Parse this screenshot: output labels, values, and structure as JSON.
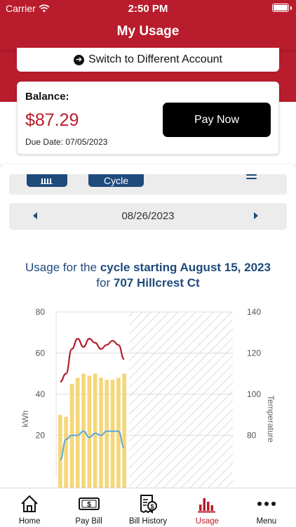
{
  "status_bar": {
    "carrier": "Carrier",
    "time": "2:50 PM"
  },
  "nav": {
    "title": "My Usage"
  },
  "account": {
    "switch_label": "Switch to Different Account"
  },
  "balance": {
    "label": "Balance:",
    "amount": "$87.29",
    "due_date": "Due Date: 07/05/2023",
    "pay_button": "Pay Now"
  },
  "view_toggle": {
    "cycle_label": "Cycle"
  },
  "date_nav": {
    "date": "08/26/2023"
  },
  "usage_heading": {
    "prefix": "Usage for the ",
    "cycle_text": "cycle starting August 15, 2023",
    "for_text": "for ",
    "address": "707 Hillcrest Ct"
  },
  "chart_data": {
    "type": "bar",
    "xlabel": "",
    "ylabel": "kWh",
    "ylabel_right": "Temperature",
    "ylim": [
      0,
      80
    ],
    "ylim_right": [
      60,
      140
    ],
    "y_ticks": [
      20,
      40,
      60,
      80
    ],
    "y_ticks_right": [
      80,
      100,
      120,
      140
    ],
    "bar_color": "#f5d77a",
    "values": [
      30,
      29,
      45,
      48,
      50,
      49,
      50,
      48,
      47,
      47,
      48,
      50
    ],
    "series": [
      {
        "values": [
          106,
          110,
          122,
          127,
          123,
          127,
          125,
          122,
          124,
          126,
          124,
          117
        ],
        "color": "#b21f2d"
      },
      {
        "values": [
          68,
          78,
          80,
          80,
          82,
          79,
          81,
          80,
          82,
          82,
          82,
          74
        ],
        "color": "#5aa7dc"
      }
    ],
    "hatched_remaining": true
  },
  "tabbar": {
    "items": [
      {
        "label": "Home",
        "icon": "home-icon"
      },
      {
        "label": "Pay Bill",
        "icon": "pay-bill-icon"
      },
      {
        "label": "Bill History",
        "icon": "bill-history-icon"
      },
      {
        "label": "Usage",
        "icon": "usage-icon"
      },
      {
        "label": "Menu",
        "icon": "menu-icon"
      }
    ],
    "active": "Usage"
  },
  "colors": {
    "brand": "#b91c2c",
    "accent": "#1e4a7c"
  }
}
